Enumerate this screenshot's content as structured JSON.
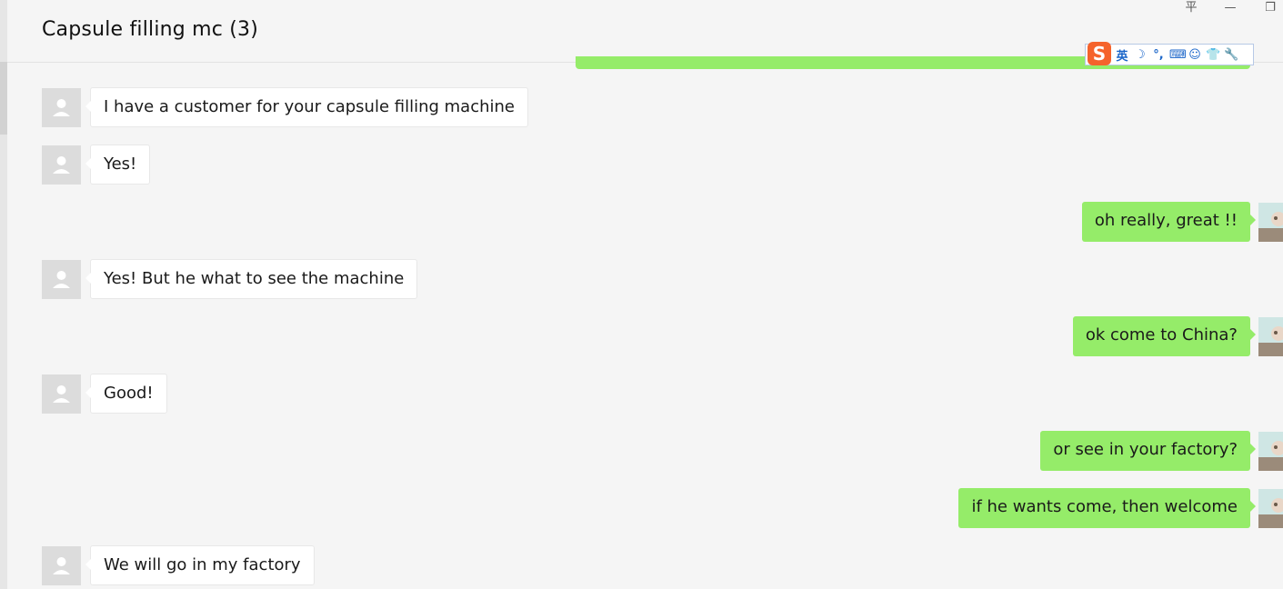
{
  "window": {
    "title": "Capsule filling mc (3)",
    "pin_glyph": "平",
    "minimize_glyph": "—",
    "restore_glyph": "❐"
  },
  "ime": {
    "logo": "S",
    "items": [
      "英",
      "☽",
      "°,",
      "⌨",
      "☺",
      "👕",
      "🔧"
    ]
  },
  "messages": [
    {
      "side": "in",
      "text": "I have a customer for your capsule filling machine"
    },
    {
      "side": "in",
      "text": "Yes!"
    },
    {
      "side": "out",
      "text": "oh really, great !!"
    },
    {
      "side": "in",
      "text": "Yes! But he what to see the machine"
    },
    {
      "side": "out",
      "text": "ok come to China?"
    },
    {
      "side": "in",
      "text": "Good!"
    },
    {
      "side": "out",
      "text": "or see in your factory?"
    },
    {
      "side": "out",
      "text": "if he wants come, then welcome"
    },
    {
      "side": "in",
      "text": "We will go in my factory"
    }
  ],
  "colors": {
    "outgoing_bubble": "#95ec69",
    "incoming_bubble": "#ffffff",
    "background": "#f5f5f5",
    "ime_logo": "#f5632c",
    "ime_icon": "#1b66c9"
  }
}
